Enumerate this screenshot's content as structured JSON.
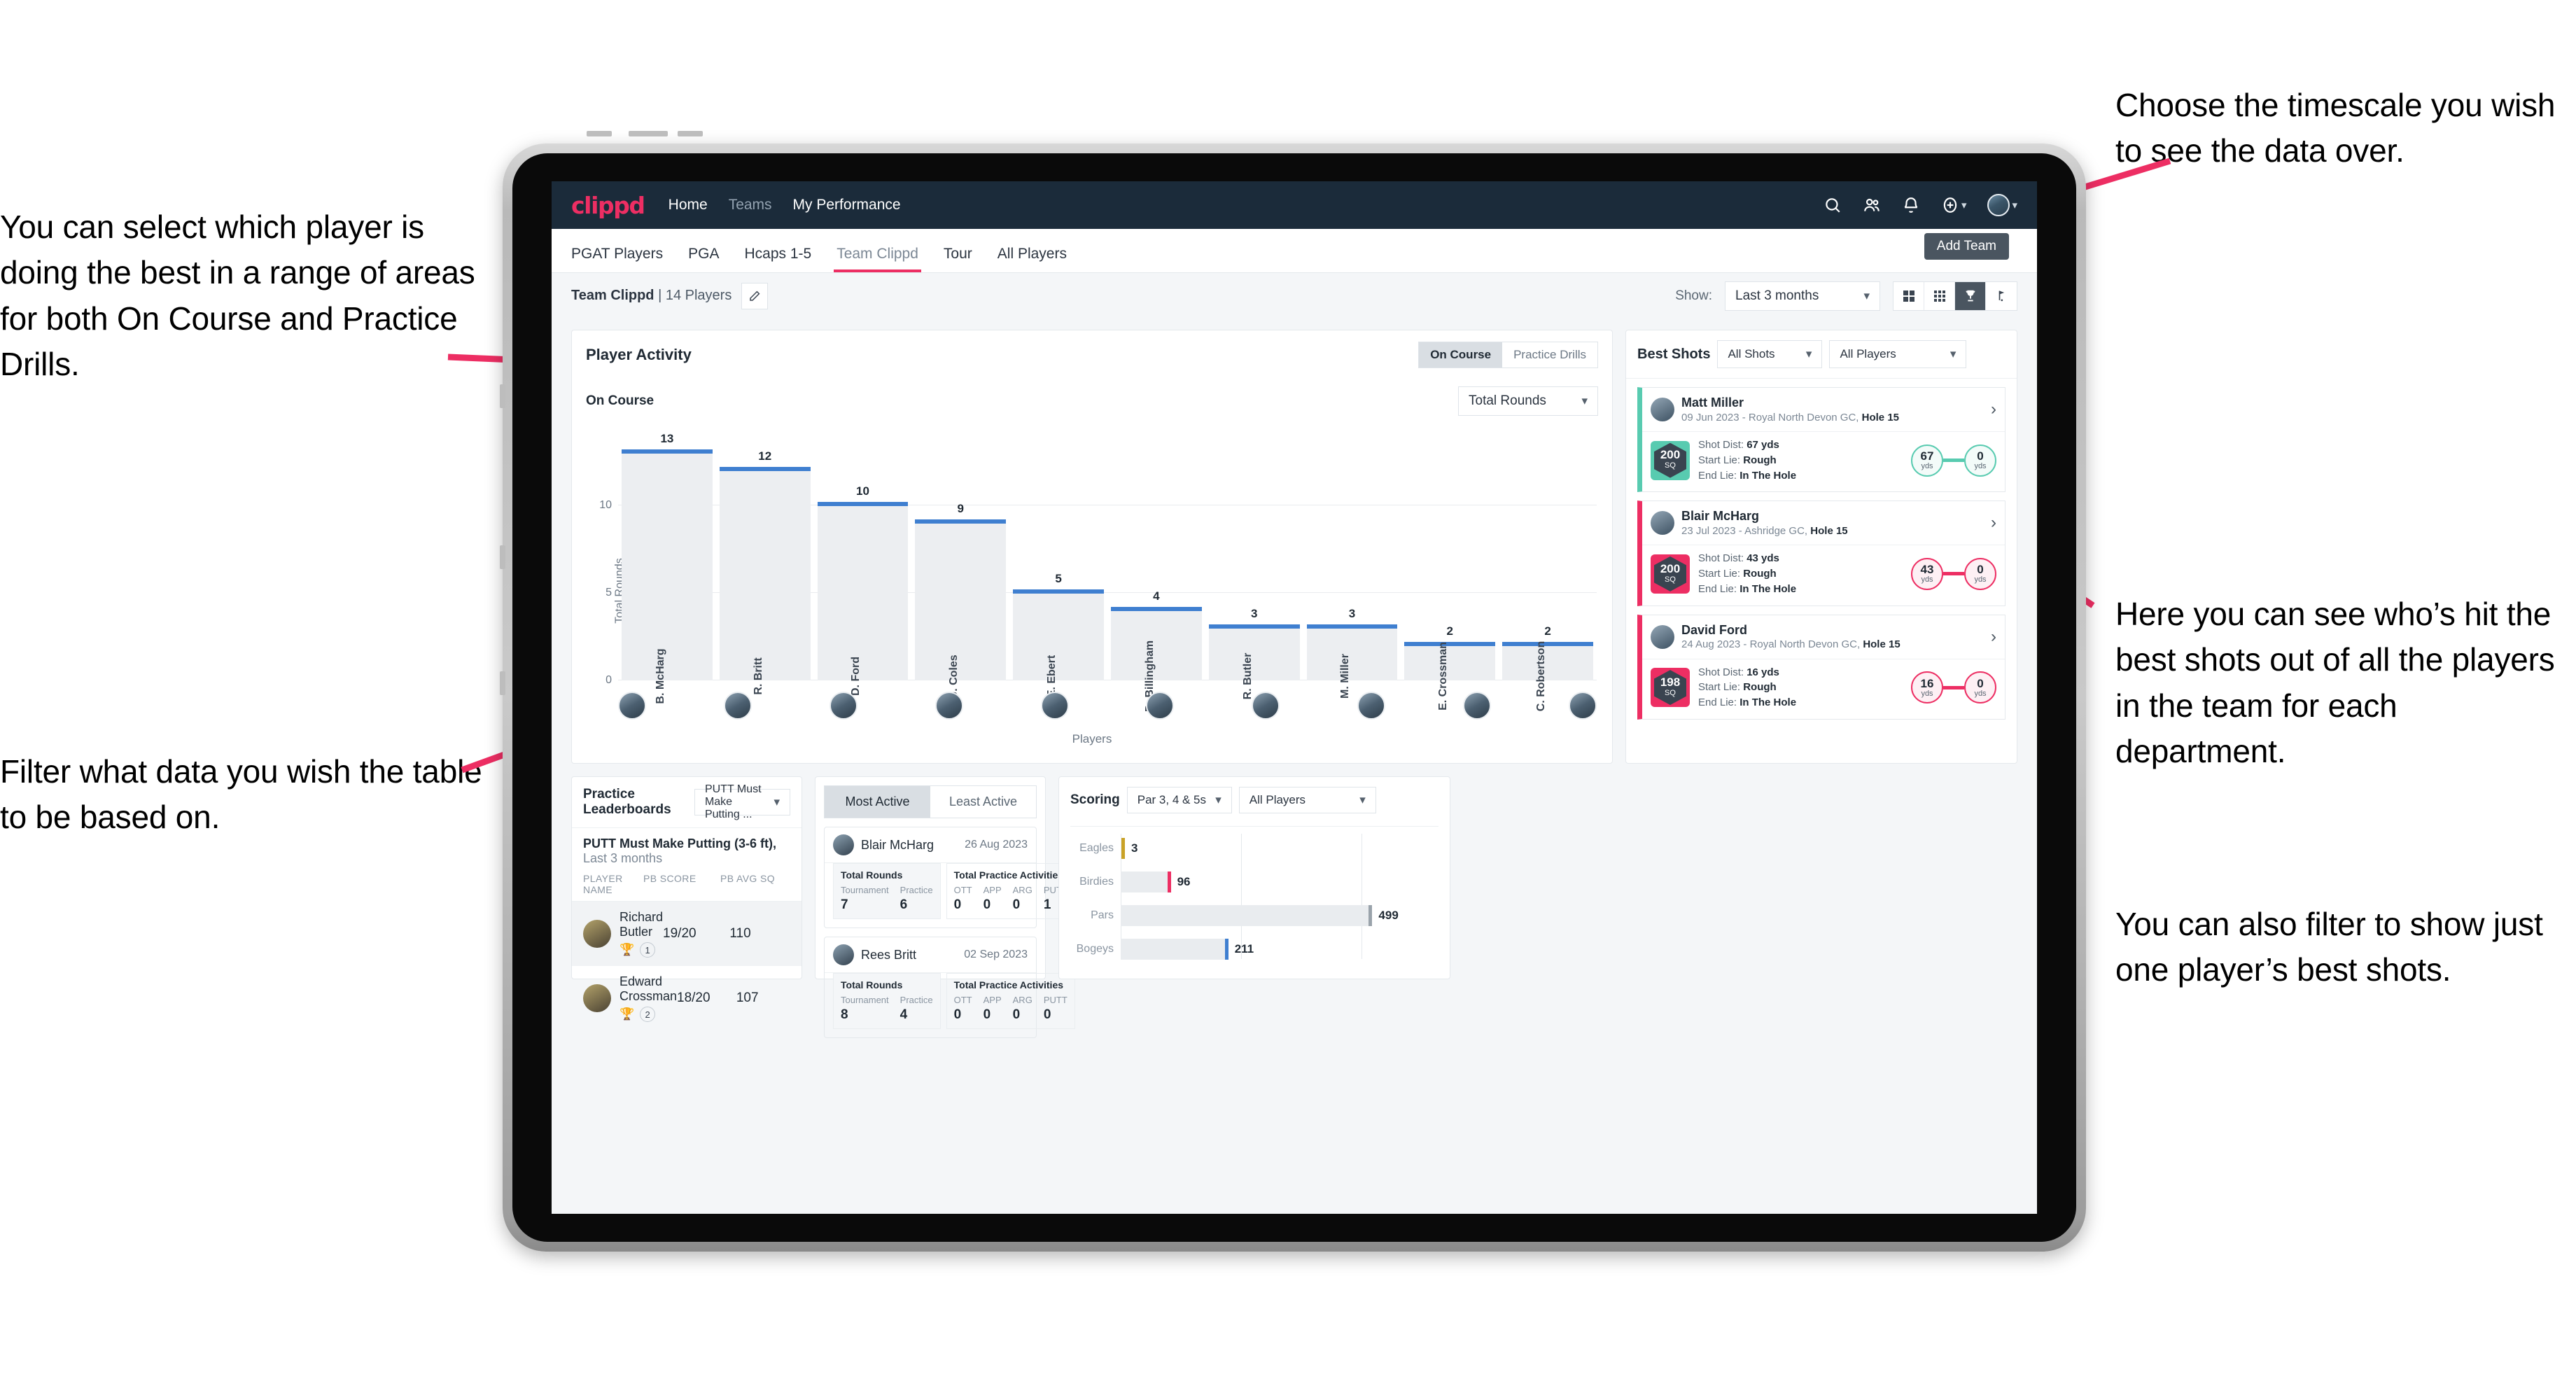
{
  "annotations": {
    "left_top": "You can select which player is doing the best in a range of areas for both On Course and Practice Drills.",
    "left_bottom": "Filter what data you wish the table to be based on.",
    "right_top": "Choose the timescale you wish to see the data over.",
    "right_mid": "Here you can see who’s hit the best shots out of all the players in the team for each department.",
    "right_bottom": "You can also filter to show just one player’s best shots."
  },
  "app": {
    "logo": "clippd",
    "nav": [
      {
        "label": "Home",
        "active": true
      },
      {
        "label": "Teams",
        "active": false
      },
      {
        "label": "My Performance",
        "active": false
      }
    ],
    "icons": {
      "search": "search-icon",
      "people": "people-icon",
      "bell": "bell-icon",
      "plus": "plus-circle-icon",
      "avatar": "user-avatar"
    }
  },
  "tabs": [
    {
      "label": "PGAT Players",
      "active": false
    },
    {
      "label": "PGA",
      "active": false
    },
    {
      "label": "Hcaps 1-5",
      "active": false
    },
    {
      "label": "Team Clippd",
      "active": true
    },
    {
      "label": "Tour",
      "active": false
    },
    {
      "label": "All Players",
      "active": false
    }
  ],
  "tooltip": {
    "add_team": "Add Team"
  },
  "subbar": {
    "team_name": "Team Clippd",
    "team_count": "| 14 Players",
    "show_label": "Show:",
    "timescale": "Last 3 months",
    "view_toggles": [
      {
        "icon": "grid-2x2-icon",
        "active": false
      },
      {
        "icon": "grid-3x3-icon",
        "active": false
      },
      {
        "icon": "trophy-icon",
        "active": true
      },
      {
        "icon": "golf-flag-icon",
        "active": false
      }
    ]
  },
  "player_activity": {
    "title": "Player Activity",
    "segments": [
      {
        "label": "On Course",
        "active": true
      },
      {
        "label": "Practice Drills",
        "active": false
      }
    ],
    "sub_label": "On Course",
    "metric": "Total Rounds",
    "chart_data": {
      "type": "bar",
      "title": "Player Activity — On Course",
      "xlabel": "Players",
      "ylabel": "Total Rounds",
      "categories": [
        "B. McHarg",
        "R. Britt",
        "D. Ford",
        "J. Coles",
        "E. Ebert",
        "D. Billingham",
        "R. Butler",
        "M. Miller",
        "E. Crossman",
        "C. Robertson"
      ],
      "values": [
        13,
        12,
        10,
        9,
        5,
        4,
        3,
        3,
        2,
        2
      ],
      "yticks": [
        0,
        5,
        10
      ],
      "ylim": [
        0,
        14
      ],
      "grid": true,
      "bar_color": "#eceef1",
      "cap_color": "#3f7fd0"
    }
  },
  "best_shots": {
    "title": "Best Shots",
    "shot_filter": "All Shots",
    "player_filter": "All Players",
    "cards": [
      {
        "accent": "teal",
        "name": "Matt Miller",
        "meta_date": "09 Jun 2023 - Royal North Devon GC,",
        "meta_hole": "Hole 15",
        "sq": "200",
        "sq_unit": "SQ",
        "shot_dist_label": "Shot Dist:",
        "shot_dist": "67 yds",
        "start_lie_label": "Start Lie:",
        "start_lie": "Rough",
        "end_lie_label": "End Lie:",
        "end_lie": "In The Hole",
        "from_value": "67",
        "from_unit": "yds",
        "to_value": "0",
        "to_unit": "yds"
      },
      {
        "accent": "pink",
        "name": "Blair McHarg",
        "meta_date": "23 Jul 2023 - Ashridge GC,",
        "meta_hole": "Hole 15",
        "sq": "200",
        "sq_unit": "SQ",
        "shot_dist_label": "Shot Dist:",
        "shot_dist": "43 yds",
        "start_lie_label": "Start Lie:",
        "start_lie": "Rough",
        "end_lie_label": "End Lie:",
        "end_lie": "In The Hole",
        "from_value": "43",
        "from_unit": "yds",
        "to_value": "0",
        "to_unit": "yds"
      },
      {
        "accent": "pink",
        "name": "David Ford",
        "meta_date": "24 Aug 2023 - Royal North Devon GC,",
        "meta_hole": "Hole 15",
        "sq": "198",
        "sq_unit": "SQ",
        "shot_dist_label": "Shot Dist:",
        "shot_dist": "16 yds",
        "start_lie_label": "Start Lie:",
        "start_lie": "Rough",
        "end_lie_label": "End Lie:",
        "end_lie": "In The Hole",
        "from_value": "16",
        "from_unit": "yds",
        "to_value": "0",
        "to_unit": "yds"
      }
    ]
  },
  "practice_leaderboards": {
    "title": "Practice Leaderboards",
    "drill_select": "PUTT Must Make Putting ...",
    "subtitle_bold": "PUTT Must Make Putting (3-6 ft),",
    "subtitle_light": "Last 3 months",
    "columns": [
      "PLAYER NAME",
      "PB SCORE",
      "PB AVG SQ"
    ],
    "rows": [
      {
        "name": "Richard Butler",
        "rank": "1",
        "medal": "gold",
        "pb_score": "19/20",
        "pb_avg_sq": "110",
        "highlight": true
      },
      {
        "name": "Edward Crossman",
        "rank": "2",
        "medal": "silver",
        "pb_score": "18/20",
        "pb_avg_sq": "107",
        "highlight": false
      }
    ]
  },
  "activity_panel": {
    "tabs": [
      {
        "label": "Most Active",
        "active": true
      },
      {
        "label": "Least Active",
        "active": false
      }
    ],
    "cards": [
      {
        "name": "Blair McHarg",
        "date": "26 Aug 2023",
        "rounds_title": "Total Rounds",
        "rounds": [
          {
            "k": "Tournament",
            "v": "7"
          },
          {
            "k": "Practice",
            "v": "6"
          }
        ],
        "practice_title": "Total Practice Activities",
        "practice": [
          {
            "k": "OTT",
            "v": "0"
          },
          {
            "k": "APP",
            "v": "0"
          },
          {
            "k": "ARG",
            "v": "0"
          },
          {
            "k": "PUTT",
            "v": "1"
          }
        ]
      },
      {
        "name": "Rees Britt",
        "date": "02 Sep 2023",
        "rounds_title": "Total Rounds",
        "rounds": [
          {
            "k": "Tournament",
            "v": "8"
          },
          {
            "k": "Practice",
            "v": "4"
          }
        ],
        "practice_title": "Total Practice Activities",
        "practice": [
          {
            "k": "OTT",
            "v": "0"
          },
          {
            "k": "APP",
            "v": "0"
          },
          {
            "k": "ARG",
            "v": "0"
          },
          {
            "k": "PUTT",
            "v": "0"
          }
        ]
      }
    ]
  },
  "scoring": {
    "title": "Scoring",
    "par_filter": "Par 3, 4 & 5s",
    "player_filter": "All Players",
    "chart_data": {
      "type": "bar",
      "orientation": "horizontal",
      "title": "Scoring",
      "categories": [
        "Eagles",
        "Birdies",
        "Pars",
        "Bogeys"
      ],
      "values": [
        3,
        96,
        499,
        211
      ],
      "cap_colors": [
        "#c9a227",
        "#ed2e63",
        "#9aa3ab",
        "#3f7fd0"
      ],
      "xlim": [
        0,
        560
      ],
      "bar_color": "#e9ecef",
      "grid": true
    }
  }
}
